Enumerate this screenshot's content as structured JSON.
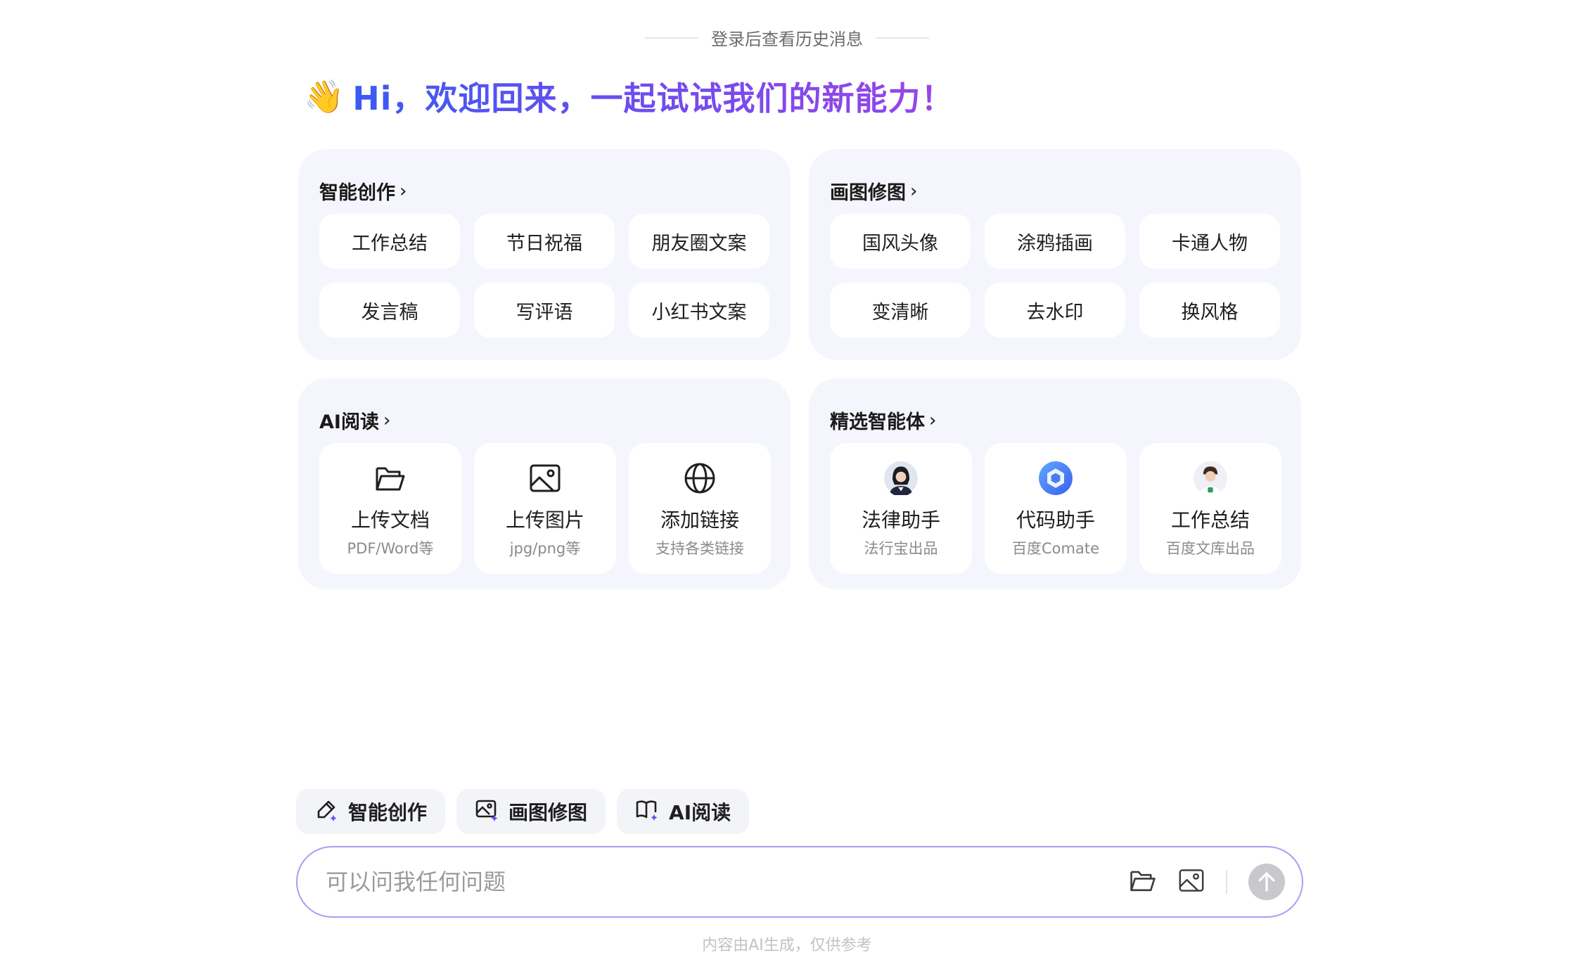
{
  "history_hint": "登录后查看历史消息",
  "greeting": {
    "emoji": "👋",
    "text": "Hi，欢迎回来，一起试试我们的新能力！"
  },
  "cards": {
    "smart_create": {
      "title": "智能创作",
      "items": [
        "工作总结",
        "节日祝福",
        "朋友圈文案",
        "发言稿",
        "写评语",
        "小红书文案"
      ]
    },
    "draw": {
      "title": "画图修图",
      "items": [
        "国风头像",
        "涂鸦插画",
        "卡通人物",
        "变清晰",
        "去水印",
        "换风格"
      ]
    },
    "ai_read": {
      "title": "AI阅读",
      "tiles": [
        {
          "name": "上传文档",
          "sub": "PDF/Word等",
          "icon": "folder-icon"
        },
        {
          "name": "上传图片",
          "sub": "jpg/png等",
          "icon": "image-icon"
        },
        {
          "name": "添加链接",
          "sub": "支持各类链接",
          "icon": "globe-icon"
        }
      ]
    },
    "agents": {
      "title": "精选智能体",
      "tiles": [
        {
          "name": "法律助手",
          "sub": "法行宝出品",
          "icon": "lawyer-avatar"
        },
        {
          "name": "代码助手",
          "sub": "百度Comate",
          "icon": "comate-logo"
        },
        {
          "name": "工作总结",
          "sub": "百度文库出品",
          "icon": "worker-avatar"
        }
      ]
    }
  },
  "tabs": [
    {
      "label": "智能创作",
      "icon": "pen-sparkle-icon"
    },
    {
      "label": "画图修图",
      "icon": "image-sparkle-icon"
    },
    {
      "label": "AI阅读",
      "icon": "book-sparkle-icon"
    }
  ],
  "input": {
    "placeholder": "可以问我任何问题",
    "value": ""
  },
  "footer_note": "内容由AI生成，仅供参考",
  "colors": {
    "accent_border": "#a99ff0",
    "card_bg": "#f5f6fd",
    "gradient_start": "#3b5bf2",
    "gradient_end": "#9c45e6"
  }
}
